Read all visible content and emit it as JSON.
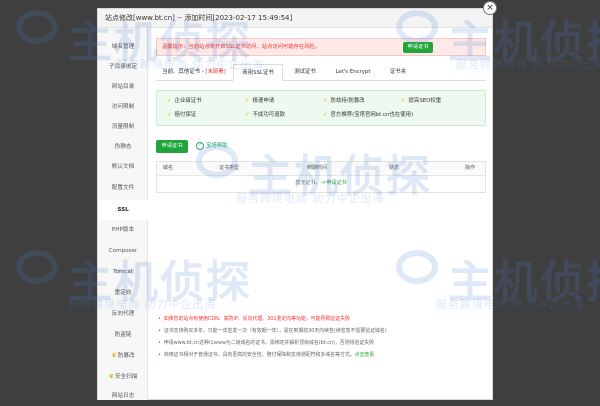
{
  "window": {
    "title": "站点修改[www.bt.cn] -- 添加时间[2023-02-17 15:49:54]",
    "close_symbol": "×"
  },
  "sidebar": {
    "items": [
      {
        "label": "域名管理"
      },
      {
        "label": "子目录绑定"
      },
      {
        "label": "网站目录"
      },
      {
        "label": "访问限制"
      },
      {
        "label": "流量限制"
      },
      {
        "label": "伪静态"
      },
      {
        "label": "默认文档"
      },
      {
        "label": "配置文件"
      },
      {
        "label": "SSL"
      },
      {
        "label": "PHP版本"
      },
      {
        "label": "Composer"
      },
      {
        "label": "Tomcat"
      },
      {
        "label": "重定向"
      },
      {
        "label": "反向代理"
      },
      {
        "label": "防盗链"
      },
      {
        "label": "防篡改"
      },
      {
        "label": "安全扫描"
      },
      {
        "label": "网站日志"
      }
    ]
  },
  "warning": {
    "text": "温馨提示：当前站点未开启SSL证书访问，站点访问可能存在风险。",
    "button": "申请证书"
  },
  "tabs": [
    {
      "label": "当前、其他证书 - ",
      "warn": "[未部署]"
    },
    {
      "label": "商用SSL证书",
      "warn": ""
    },
    {
      "label": "测试证书",
      "warn": ""
    },
    {
      "label": "Let's Encrypt",
      "warn": ""
    },
    {
      "label": "证书夹",
      "warn": ""
    }
  ],
  "features": [
    "企业级证书",
    "极速申请",
    "防劫持/防篡改",
    "提高SEO权重",
    "赔付保证",
    "不成功可退款",
    "官方推荐(宝塔官网bt.cn也在使用)"
  ],
  "actions": {
    "apply": "申请证书",
    "help_icon": "?",
    "help": "宝塔帮助"
  },
  "table": {
    "headers": [
      "域名",
      "证书类型",
      "到期时间",
      "状态",
      "操作"
    ],
    "empty_prefix": "暂无证书，",
    "empty_link": "->申请证书"
  },
  "notes": [
    {
      "text": "如果您的站点有使用CDN、高防IP、反向代理、301重定向等功能，可能导致验证失败",
      "link": ""
    },
    {
      "text": "证书支持购买多年，只能一年签发一次（有效期一年），需在到期前30天内续签(续签暂不需要验证域名)",
      "link": ""
    },
    {
      "text": "申请www.bt.cn这种以www为二级域名的证书，需绑定并解析顶级域名(bt.cn)，否则将验证失败",
      "link": ""
    },
    {
      "text": "商用证书相对于普通证书，具有更高的安全性、赔付保障和支持通配符和多域名等方式。",
      "link": "点击查看"
    }
  ],
  "watermark": {
    "name": "主机侦探",
    "slogan": "服务跨境电商 助力中企出海"
  },
  "colors": {
    "accent": "#20a53a",
    "warning_text": "#ee3333",
    "check": "#f0a000"
  }
}
